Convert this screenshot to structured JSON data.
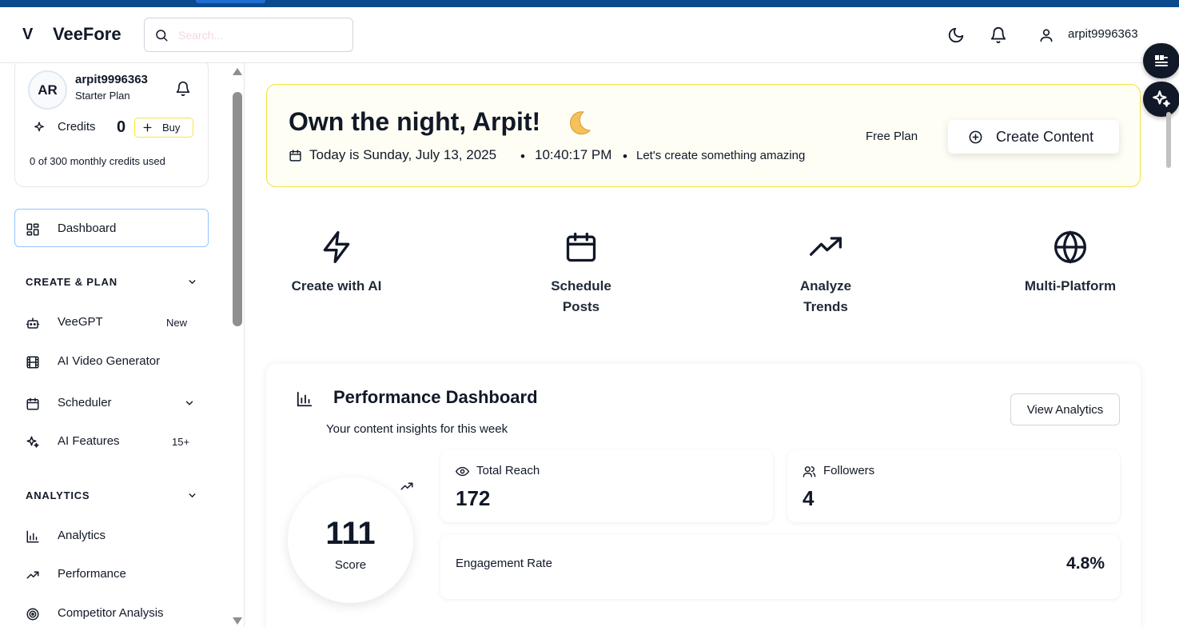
{
  "header": {
    "logo_mark": "V",
    "brand": "VeeFore",
    "search_placeholder": "Search...",
    "username": "arpit9996363"
  },
  "user_card": {
    "initials": "AR",
    "username": "arpit9996363",
    "plan": "Starter Plan",
    "credits_label": "Credits",
    "credits_value": "0",
    "buy_label": "Buy",
    "usage_text": "0 of 300 monthly credits used"
  },
  "sidebar": {
    "dashboard_label": "Dashboard",
    "section_create": "CREATE & PLAN",
    "veegpt_label": "VeeGPT",
    "veegpt_badge": "New",
    "video_label": "AI Video Generator",
    "scheduler_label": "Scheduler",
    "ai_features_label": "AI Features",
    "ai_features_badge": "15+",
    "section_analytics": "ANALYTICS",
    "analytics_label": "Analytics",
    "performance_label": "Performance",
    "competitor_label": "Competitor Analysis"
  },
  "hero": {
    "title": "Own the night, Arpit!",
    "date_text": "Today is Sunday, July 13, 2025",
    "dot": "•",
    "time_text": "10:40:17 PM",
    "tagline": "Let's create something amazing",
    "plan_label": "Free Plan",
    "cta_label": "Create Content"
  },
  "features": {
    "create_ai": "Create with AI",
    "schedule_line1": "Schedule",
    "schedule_line2": "Posts",
    "analyze_line1": "Analyze",
    "analyze_line2": "Trends",
    "multi": "Multi-Platform"
  },
  "performance": {
    "title": "Performance Dashboard",
    "subtitle": "Your content insights for this week",
    "view_button": "View Analytics",
    "score_value": "111",
    "score_label": "Score",
    "reach_label": "Total Reach",
    "reach_value": "172",
    "followers_label": "Followers",
    "followers_value": "4",
    "engagement_label": "Engagement Rate",
    "engagement_value": "4.8%"
  },
  "colors": {
    "top_stripe": "#0b4a8c",
    "hero_border": "#f0e43c",
    "dashboard_border": "#93c5fd",
    "fab_bg": "#111827"
  }
}
